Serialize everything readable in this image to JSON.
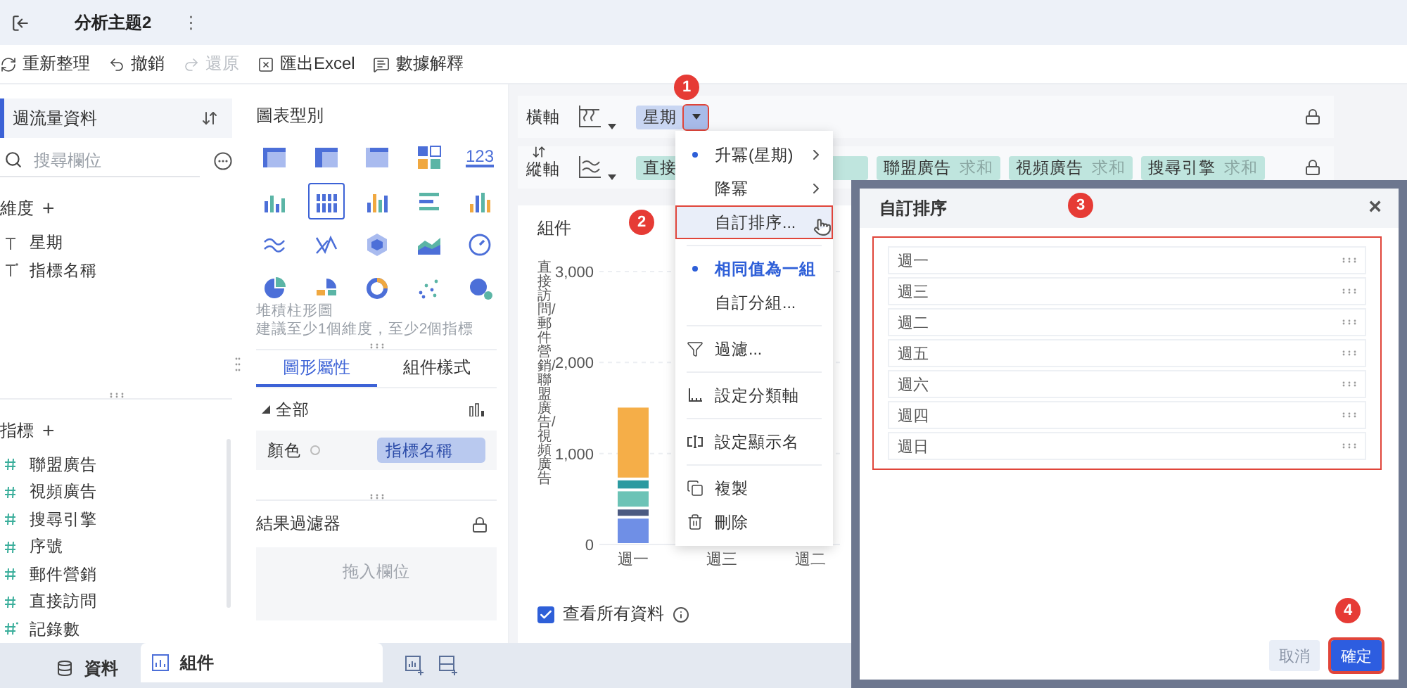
{
  "top_bar": {
    "tab_title": "分析主题2",
    "more": "⋮"
  },
  "toolbar": [
    {
      "label": "重新整理",
      "kind": "refresh",
      "disabled": false
    },
    {
      "label": "撤銷",
      "kind": "undo",
      "disabled": false
    },
    {
      "label": "還原",
      "kind": "redo",
      "disabled": true
    },
    {
      "label": "匯出Excel",
      "kind": "export",
      "disabled": false
    },
    {
      "label": "數據解釋",
      "kind": "explain",
      "disabled": false
    }
  ],
  "data_panel": {
    "dataset": "週流量資料",
    "search": {
      "placeholder": "搜尋欄位"
    },
    "dimensions": {
      "title": "維度",
      "add": "+",
      "items": [
        {
          "label": "星期",
          "kind": "text"
        },
        {
          "label": "指標名稱",
          "kind": "derived_text"
        }
      ]
    },
    "measures": {
      "title": "指標",
      "add": "+",
      "items": [
        {
          "label": "聯盟廣告",
          "kind": "number"
        },
        {
          "label": "視頻廣告",
          "kind": "number"
        },
        {
          "label": "搜尋引擎",
          "kind": "number"
        },
        {
          "label": "序號",
          "kind": "number"
        },
        {
          "label": "郵件營銷",
          "kind": "number"
        },
        {
          "label": "直接訪問",
          "kind": "number"
        },
        {
          "label": "記錄數",
          "kind": "derived_number"
        }
      ]
    }
  },
  "chart_panel": {
    "title": "圖表型別",
    "chart_types": [
      {
        "selected": false
      },
      {
        "selected": false
      },
      {
        "selected": false
      },
      {
        "selected": false
      },
      {
        "selected": false,
        "label": "123"
      },
      {
        "selected": false
      },
      {
        "selected": true
      },
      {
        "selected": false
      },
      {
        "selected": false
      },
      {
        "selected": false
      },
      {
        "selected": false
      },
      {
        "selected": false
      },
      {
        "selected": false
      },
      {
        "selected": false
      },
      {
        "selected": false
      },
      {
        "selected": false
      },
      {
        "selected": false
      },
      {
        "selected": false
      },
      {
        "selected": false
      },
      {
        "selected": false
      }
    ],
    "chart_name": "堆積柱形圖",
    "hint": "建議至少1個維度，至少2個指標",
    "tabs": [
      {
        "label": "圖形屬性",
        "selected": true
      },
      {
        "label": "組件樣式",
        "selected": false
      }
    ],
    "group": {
      "label": "全部",
      "expanded": true
    },
    "color_field": {
      "label": "顏色",
      "value": "指標名稱"
    },
    "result_filter": {
      "title": "結果過濾器",
      "placeholder": "拖入欄位"
    }
  },
  "axes": [
    {
      "label": "橫軸",
      "fields": [
        {
          "name": "星期",
          "kind": "dimension",
          "menu_open": true,
          "highlighted": true
        }
      ]
    },
    {
      "label": "縱軸",
      "fields": [
        {
          "name": "直接",
          "kind": "measure"
        },
        {
          "name": "聯盟廣告",
          "aggregate": "求和",
          "kind": "measure"
        },
        {
          "name": "視頻廣告",
          "aggregate": "求和",
          "kind": "measure"
        },
        {
          "name": "搜尋引擎",
          "aggregate": "求和",
          "kind": "measure"
        }
      ]
    }
  ],
  "chart": {
    "title": "組件",
    "chart_data": {
      "type": "bar",
      "stacked": true,
      "ylabel": "直接訪問/郵件營銷/聯盟廣告/視頻廣告",
      "categories": [
        "週一",
        "週三",
        "週二"
      ],
      "ylim": [
        0,
        3000
      ],
      "yticks": [
        {
          "value": 0,
          "label": "0"
        },
        {
          "value": 1000,
          "label": "1,000"
        },
        {
          "value": 2000,
          "label": "2,000"
        },
        {
          "value": 3000,
          "label": "3,000"
        }
      ],
      "series": [
        {
          "color": "#6f8fe6",
          "values": [
            300,
            null,
            null
          ]
        },
        {
          "color": "#4b5a82",
          "values": [
            100,
            null,
            null
          ]
        },
        {
          "color": "#6cc3b6",
          "values": [
            200,
            null,
            null
          ]
        },
        {
          "color": "#2b9aa0",
          "values": [
            120,
            null,
            null
          ]
        },
        {
          "color": "#f5ae48",
          "values": [
            800,
            null,
            null
          ]
        }
      ]
    },
    "show_all": {
      "label": "查看所有資料",
      "checked": true
    }
  },
  "menu": {
    "items": [
      {
        "label": "升冪(星期)",
        "kind": "sort",
        "checked": true,
        "selected": false,
        "submenu": true,
        "hovered": false,
        "divider_before": false
      },
      {
        "label": "降冪",
        "kind": "sort",
        "checked": false,
        "selected": false,
        "submenu": true,
        "hovered": false,
        "divider_before": false
      },
      {
        "label": "自訂排序...",
        "kind": "sort",
        "checked": false,
        "selected": false,
        "submenu": false,
        "hovered": true,
        "divider_before": false
      },
      {
        "label": "相同值為一組",
        "kind": "group",
        "checked": true,
        "selected": true,
        "submenu": false,
        "hovered": false,
        "divider_before": true
      },
      {
        "label": "自訂分組...",
        "kind": "group",
        "checked": false,
        "selected": false,
        "submenu": false,
        "hovered": false,
        "divider_before": false
      },
      {
        "label": "過濾...",
        "kind": "filter",
        "checked": false,
        "selected": false,
        "submenu": false,
        "hovered": false,
        "divider_before": true
      },
      {
        "label": "設定分類軸",
        "kind": "axis",
        "checked": false,
        "selected": false,
        "submenu": false,
        "hovered": false,
        "divider_before": true
      },
      {
        "label": "設定顯示名",
        "kind": "rename",
        "checked": false,
        "selected": false,
        "submenu": false,
        "hovered": false,
        "divider_before": true
      },
      {
        "label": "複製",
        "kind": "copy",
        "checked": false,
        "selected": false,
        "submenu": false,
        "hovered": false,
        "divider_before": true
      },
      {
        "label": "刪除",
        "kind": "delete",
        "checked": false,
        "selected": false,
        "submenu": false,
        "hovered": false,
        "divider_before": false
      }
    ]
  },
  "dialog": {
    "title": "自訂排序",
    "close": "×",
    "highlighted": true,
    "items": [
      {
        "label": "週一"
      },
      {
        "label": "週三"
      },
      {
        "label": "週二"
      },
      {
        "label": "週五"
      },
      {
        "label": "週六"
      },
      {
        "label": "週四"
      },
      {
        "label": "週日"
      }
    ],
    "buttons": [
      {
        "label": "取消",
        "kind": "secondary",
        "highlighted": false
      },
      {
        "label": "確定",
        "kind": "primary",
        "highlighted": true
      }
    ]
  },
  "step_markers": [
    {
      "label": "1"
    },
    {
      "label": "2"
    },
    {
      "label": "3"
    },
    {
      "label": "4"
    }
  ],
  "bottom_bar": {
    "tabs": [
      {
        "label": "資料",
        "kind": "data",
        "selected": false
      },
      {
        "label": "組件",
        "kind": "component",
        "selected": true
      }
    ]
  }
}
